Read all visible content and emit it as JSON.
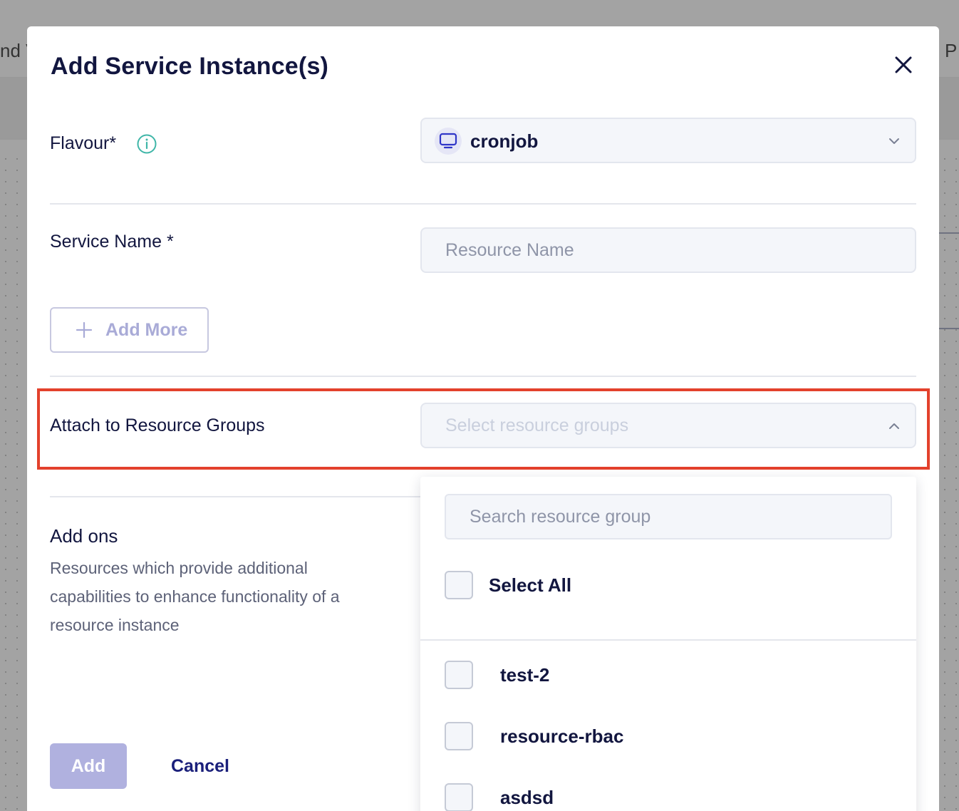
{
  "background": {
    "left_fragment": "nd V",
    "right_fragment": "P"
  },
  "modal": {
    "title": "Add Service Instance(s)",
    "close_icon": "close-icon"
  },
  "flavour": {
    "label": "Flavour*",
    "info_icon": "info-icon",
    "value": "cronjob",
    "icon": "monitor-icon"
  },
  "service_name": {
    "label": "Service Name *",
    "placeholder": "Resource Name"
  },
  "add_more": {
    "label": "Add More"
  },
  "resource_groups": {
    "label": "Attach to Resource Groups",
    "placeholder": "Select resource groups",
    "search_placeholder": "Search resource group",
    "select_all": "Select All",
    "options": [
      "test-2",
      "resource-rbac",
      "asdsd"
    ]
  },
  "addons": {
    "title": "Add ons",
    "description": "Resources which provide additional capabilities to enhance functionality of a resource instance"
  },
  "footer": {
    "add_label": "Add",
    "cancel_label": "Cancel"
  },
  "colors": {
    "accent": "#1a1f7a",
    "highlight": "#e3412c",
    "add_button": "#b0b1df"
  }
}
